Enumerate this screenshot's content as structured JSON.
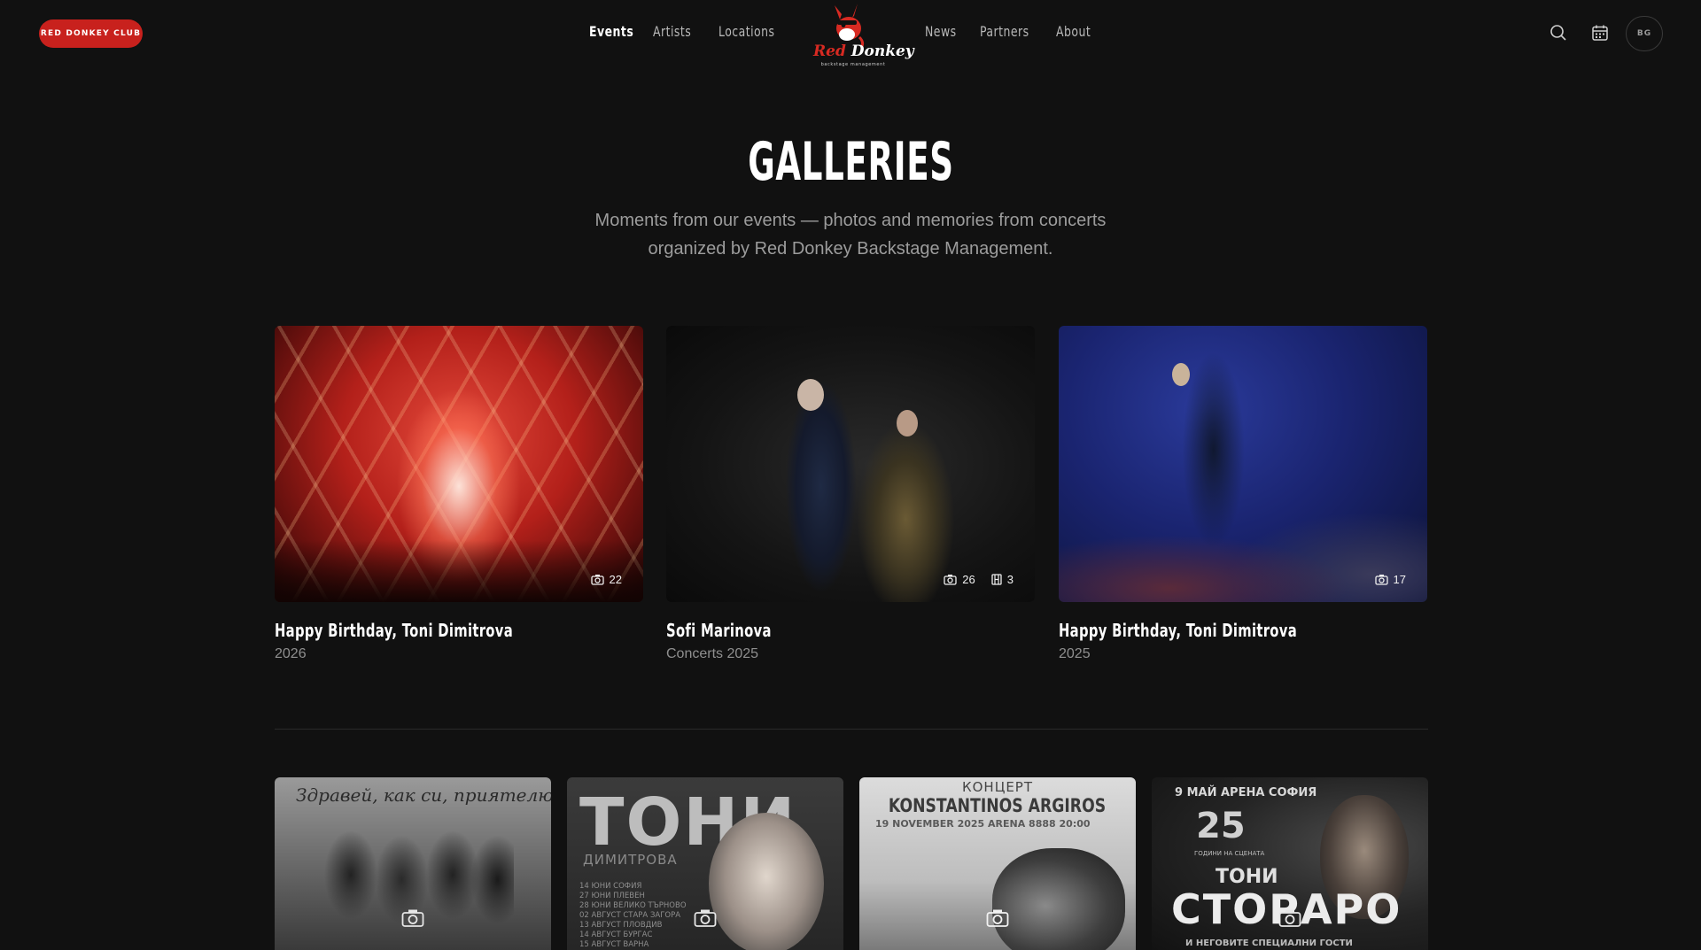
{
  "header": {
    "club_button": "RED DONKEY CLUB",
    "nav_left": [
      "Events",
      "Artists",
      "Locations"
    ],
    "nav_right": [
      "News",
      "Partners",
      "About"
    ],
    "logo_text_red": "Red",
    "logo_text_white": "Donkey",
    "logo_sub": "backstage management",
    "lang": "BG",
    "icons": [
      "search-icon",
      "calendar-icon"
    ]
  },
  "hero": {
    "title": "GALLERIES",
    "subtitle_line1": "Moments from our events — photos and memories from concerts",
    "subtitle_line2": "organized by Red Donkey Backstage Management."
  },
  "galleries": [
    {
      "title": "Happy Birthday, Toni Dimitrova",
      "meta": "2026",
      "photos": "22"
    },
    {
      "title": "Sofi Marinova",
      "meta": "Concerts 2025",
      "photos": "26",
      "videos": "3"
    },
    {
      "title": "Happy Birthday, Toni Dimitrova",
      "meta": "2025",
      "photos": "17"
    }
  ],
  "posters": [
    {
      "headline": "Здравей, как си, приятелю?"
    },
    {
      "headline": "ТОНИ",
      "sub": "ДИМИТРОВА",
      "dates": [
        "14 ЮНИ  СОФИЯ",
        "27 ЮНИ  ПЛЕВЕН",
        "28 ЮНИ  ВЕЛИКО ТЪРНОВО",
        "02 АВГУСТ  СТАРА ЗАГОРА",
        "13 АВГУСТ  ПЛОВДИВ",
        "14 АВГУСТ  БУРГАС",
        "15 АВГУСТ  ВАРНА"
      ]
    },
    {
      "kicker": "КОНЦЕРТ",
      "headline": "KONSTANTINOS ARGIROS",
      "info": "19 NOVEMBER 2025   ARENA 8888   20:00"
    },
    {
      "kicker": "9 МАЙ  АРЕНА СОФИЯ",
      "number": "25",
      "laurel": "ГОДИНИ НА СЦЕНАТА",
      "headline_top": "ТОНИ",
      "headline": "СТОРАРО",
      "footer": "И НЕГОВИТЕ СПЕЦИАЛНИ ГОСТИ"
    }
  ],
  "colors": {
    "accent": "#c8211d",
    "background": "#111111"
  }
}
